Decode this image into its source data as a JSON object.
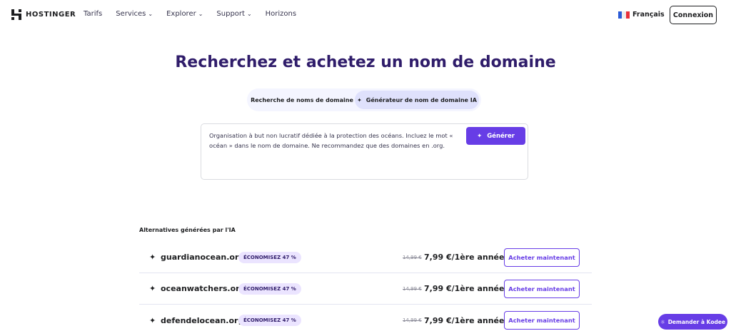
{
  "header": {
    "brand": "HOSTINGER",
    "menu": [
      {
        "label": "Tarifs",
        "dropdown": false
      },
      {
        "label": "Services",
        "dropdown": true
      },
      {
        "label": "Explorer",
        "dropdown": true
      },
      {
        "label": "Support",
        "dropdown": true
      },
      {
        "label": "Horizons",
        "dropdown": false
      }
    ],
    "language": "Français",
    "login": "Connexion"
  },
  "main": {
    "title": "Recherchez et achetez un nom de domaine",
    "tabs": [
      {
        "label": "Recherche de noms de domaine",
        "active": false
      },
      {
        "label": "Générateur de nom de domaine IA",
        "active": true
      }
    ],
    "prompt": "Organisation à but non lucratif dédiée à la protection des océans. Incluez le mot « océan » dans le nom de domaine. Ne recommandez que des domaines en .org.",
    "generate": "Générer"
  },
  "results": {
    "title": "Alternatives générées par l'IA",
    "items": [
      {
        "domain": "guardianocean.org",
        "badge": "ÉCONOMISEZ 47 %",
        "old_price": "14,99 €",
        "price": "7,99 €/1ère année",
        "button": "Acheter maintenant"
      },
      {
        "domain": "oceanwatchers.org",
        "badge": "ÉCONOMISEZ 47 %",
        "old_price": "14,99 €",
        "price": "7,99 €/1ère année",
        "button": "Acheter maintenant"
      },
      {
        "domain": "defendelocean.org",
        "badge": "ÉCONOMISEZ 47 %",
        "old_price": "14,99 €",
        "price": "7,99 €/1ère année",
        "button": "Acheter maintenant"
      }
    ]
  },
  "chat": {
    "label": "Demander à Kodee"
  },
  "colors": {
    "accent": "#673de6",
    "title": "#2f1c6a"
  }
}
